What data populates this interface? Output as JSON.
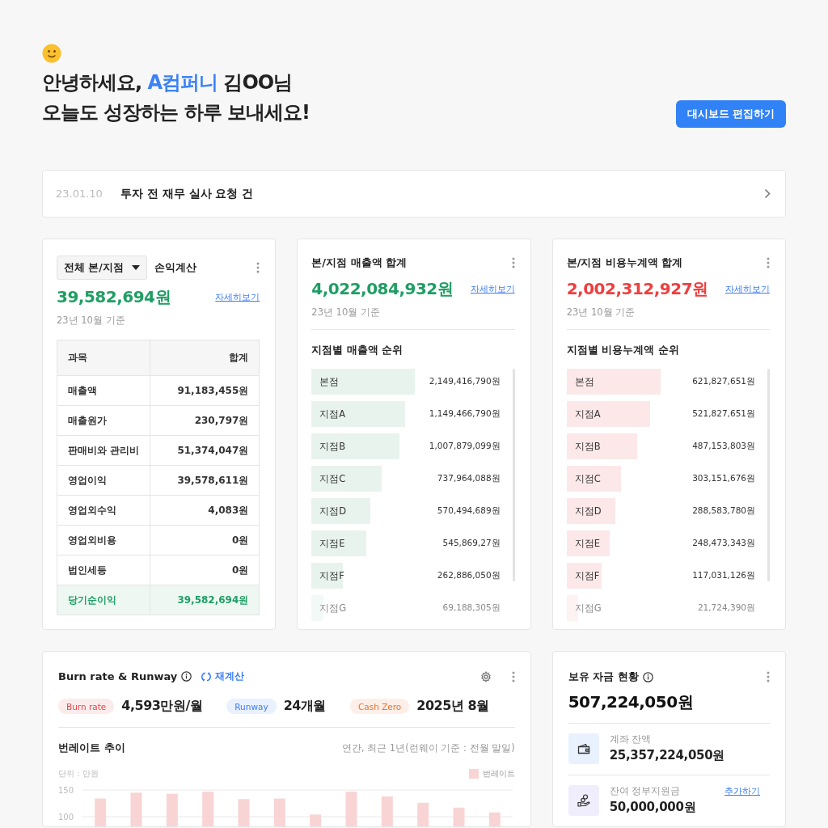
{
  "greeting": {
    "line1": [
      {
        "text": "안녕하세요,",
        "accent": false
      },
      {
        "text": "A컴퍼니",
        "accent": true
      },
      {
        "text": "김OO님",
        "accent": false
      }
    ],
    "line2": "오늘도 성장하는 하루 보내세요!"
  },
  "edit_button": "대시보드 편집하기",
  "notice": {
    "date": "23.01.10",
    "title": "투자 전 재무 실사 요청 건"
  },
  "cards": [
    {
      "kind": "table",
      "filter": "전체 본/지점",
      "title": "손익계산",
      "total": "39,582,694원",
      "negative": false,
      "link": "자세히보기",
      "basis": "23년 10월 기준",
      "table": {
        "columns": [
          "과목",
          "합계"
        ],
        "rows": [
          {
            "cells": [
              "매출액",
              "91,183,455원"
            ],
            "total": false
          },
          {
            "cells": [
              "매출원가",
              "230,797원"
            ],
            "total": false
          },
          {
            "cells": [
              "판매비와 관리비",
              "51,374,047원"
            ],
            "total": false
          },
          {
            "cells": [
              "영업이익",
              "39,578,611원"
            ],
            "total": false
          },
          {
            "cells": [
              "영업외수익",
              "4,083원"
            ],
            "total": false
          },
          {
            "cells": [
              "영업외비용",
              "0원"
            ],
            "total": false
          },
          {
            "cells": [
              "법인세등",
              "0원"
            ],
            "total": false
          },
          {
            "cells": [
              "당기순이익",
              "39,582,694원"
            ],
            "total": true
          }
        ]
      }
    },
    {
      "kind": "ranking",
      "title": "본/지점 매출액 합계",
      "total": "4,022,084,932원",
      "negative": false,
      "link": "자세히보기",
      "basis": "23년 10월 기준",
      "ranking_title": "지점별 매출액 순위",
      "items": [
        {
          "name": "본점",
          "amount": "2,149,416,790원",
          "level": 0.53,
          "faded": false
        },
        {
          "name": "지점A",
          "amount": "1,149,466,790원",
          "level": 0.48,
          "faded": false
        },
        {
          "name": "지점B",
          "amount": "1,007,879,099원",
          "level": 0.45,
          "faded": false
        },
        {
          "name": "지점C",
          "amount": "737,964,088원",
          "level": 0.36,
          "faded": false
        },
        {
          "name": "지점D",
          "amount": "570,494,689원",
          "level": 0.3,
          "faded": false
        },
        {
          "name": "지점E",
          "amount": "545,869,27원",
          "level": 0.28,
          "faded": false
        },
        {
          "name": "지점F",
          "amount": "262,886,050원",
          "level": 0.16,
          "faded": false
        },
        {
          "name": "지점G",
          "amount": "69,188,305원",
          "level": 0.06,
          "faded": true
        }
      ]
    },
    {
      "kind": "ranking",
      "title": "본/지점 비용누계액 합계",
      "total": "2,002,312,927원",
      "negative": true,
      "link": "자세히보기",
      "basis": "23년 10월 기준",
      "ranking_title": "지점별 비용누계액 순위",
      "items": [
        {
          "name": "본점",
          "amount": "621,827,651원",
          "level": 0.48,
          "faded": false
        },
        {
          "name": "지점A",
          "amount": "521,827,651원",
          "level": 0.43,
          "faded": false
        },
        {
          "name": "지점B",
          "amount": "487,153,803원",
          "level": 0.36,
          "faded": false
        },
        {
          "name": "지점C",
          "amount": "303,151,676원",
          "level": 0.28,
          "faded": false
        },
        {
          "name": "지점D",
          "amount": "288,583,780원",
          "level": 0.25,
          "faded": false
        },
        {
          "name": "지점E",
          "amount": "248,473,343원",
          "level": 0.22,
          "faded": false
        },
        {
          "name": "지점F",
          "amount": "117,031,126원",
          "level": 0.18,
          "faded": false
        },
        {
          "name": "지점G",
          "amount": "21,724,390원",
          "level": 0.06,
          "faded": true
        }
      ]
    }
  ],
  "burn": {
    "title": "Burn rate & Runway",
    "recalc": "재계산",
    "metrics": [
      {
        "label": "Burn rate",
        "value": "4,593만원/월",
        "color": "#e5484d"
      },
      {
        "label": "Runway",
        "value": "24개월",
        "color": "#3b7cf6"
      },
      {
        "label": "Cash Zero",
        "value": "2025년 8월",
        "color": "#f0702b"
      }
    ],
    "trend_title": "번레이트 추이",
    "trend_note": "연간, 최근 1년(런웨이 기준 : 전월 말일)",
    "unit": "단위 : 만원",
    "chart_data": {
      "type": "bar",
      "ylim": [
        0,
        150
      ],
      "yticks": [
        100,
        150
      ],
      "series": [
        {
          "name": "번레이트",
          "color": "#f9d4d4",
          "values": [
            134,
            145,
            143,
            147,
            133,
            134,
            104,
            147,
            138,
            126,
            117,
            108
          ]
        }
      ]
    }
  },
  "funds": {
    "title": "보유 자금 현황",
    "total": "507,224,050원",
    "items": [
      {
        "kind": "account",
        "label": "계좌 잔액",
        "amount": "25,357,224,050원"
      },
      {
        "kind": "grant",
        "label": "잔여 정부지원금",
        "amount": "50,000,000원",
        "action": "추가하기"
      }
    ]
  }
}
